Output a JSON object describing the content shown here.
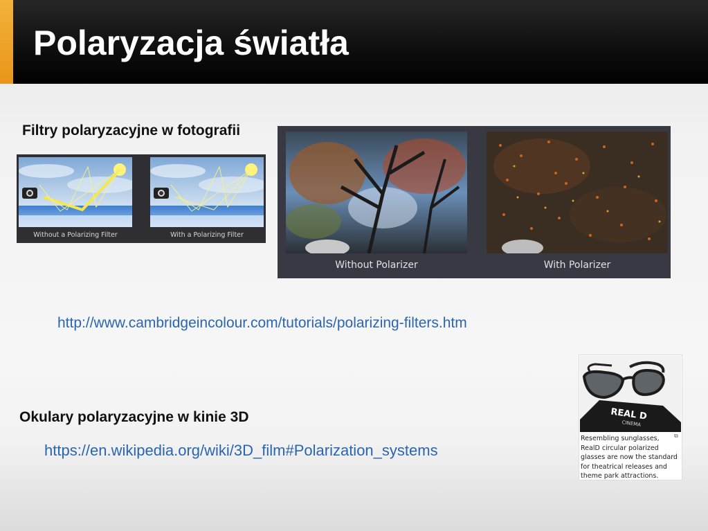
{
  "slide": {
    "title": "Polaryzacja światła",
    "heading_photo": "Filtry polaryzacyjne w fotografii",
    "heading_cinema": "Okulary polaryzacyjne w kinie 3D",
    "link_photo": "http://www.cambridgeincolour.com/tutorials/polarizing-filters.htm",
    "link_cinema": "https://en.wikipedia.org/wiki/3D_film#Polarization_systems"
  },
  "diagram": {
    "caption_left": "Without a Polarizing Filter",
    "caption_right": "With a Polarizing Filter"
  },
  "photos": {
    "caption_left": "Without Polarizer",
    "caption_right": "With Polarizer"
  },
  "thumbnail": {
    "caption": "Resembling sunglasses, RealD circular polarized glasses are now the standard for theatrical releases and theme park attractions.",
    "logo_text": "REAL D",
    "logo_sub": "CINEMA"
  },
  "colors": {
    "accent": "#f0a52a",
    "link": "#2a65b0",
    "header": "#000000"
  }
}
